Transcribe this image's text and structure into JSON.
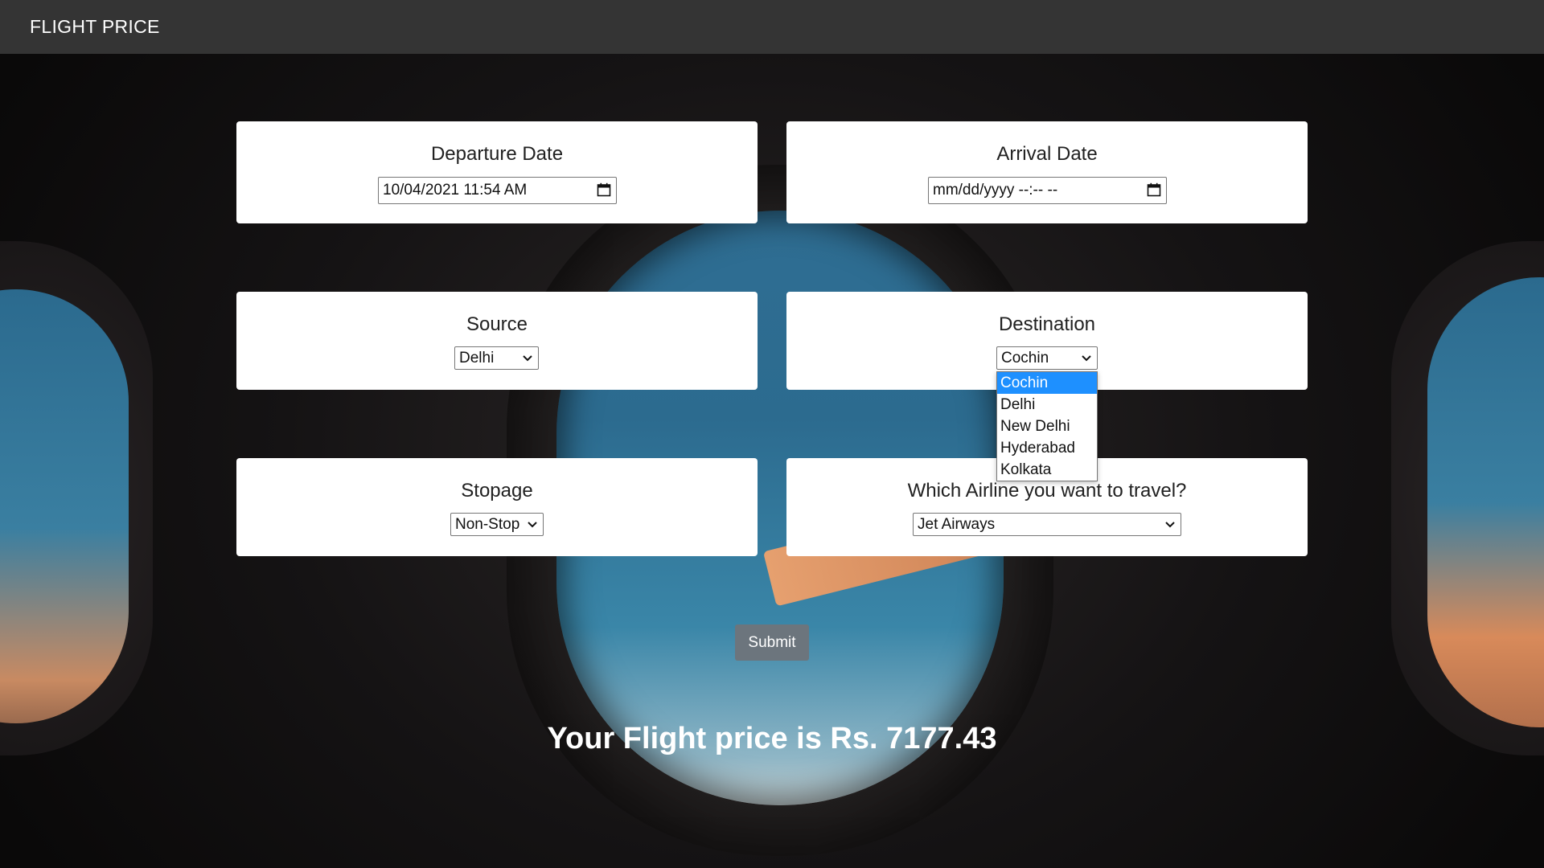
{
  "app": {
    "brand": "FLIGHT PRICE"
  },
  "departure": {
    "title": "Departure Date",
    "value": "10/04/2021  11:54  AM"
  },
  "arrival": {
    "title": "Arrival Date",
    "placeholder": "mm/dd/yyyy  --:--  --"
  },
  "source": {
    "title": "Source",
    "value": "Delhi"
  },
  "destination": {
    "title": "Destination",
    "value": "Cochin",
    "options": [
      "Cochin",
      "Delhi",
      "New Delhi",
      "Hyderabad",
      "Kolkata"
    ],
    "highlighted": "Cochin"
  },
  "stopage": {
    "title": "Stopage",
    "value": "Non-Stop"
  },
  "airline": {
    "title": "Which Airline you want to travel?",
    "value": "Jet Airways"
  },
  "submit": {
    "label": "Submit"
  },
  "result": {
    "text": "Your Flight price is Rs. 7177.43"
  },
  "colors": {
    "navbar": "#343434",
    "card": "#ffffff",
    "submit": "#6c757d",
    "highlight": "#1e90ff"
  }
}
